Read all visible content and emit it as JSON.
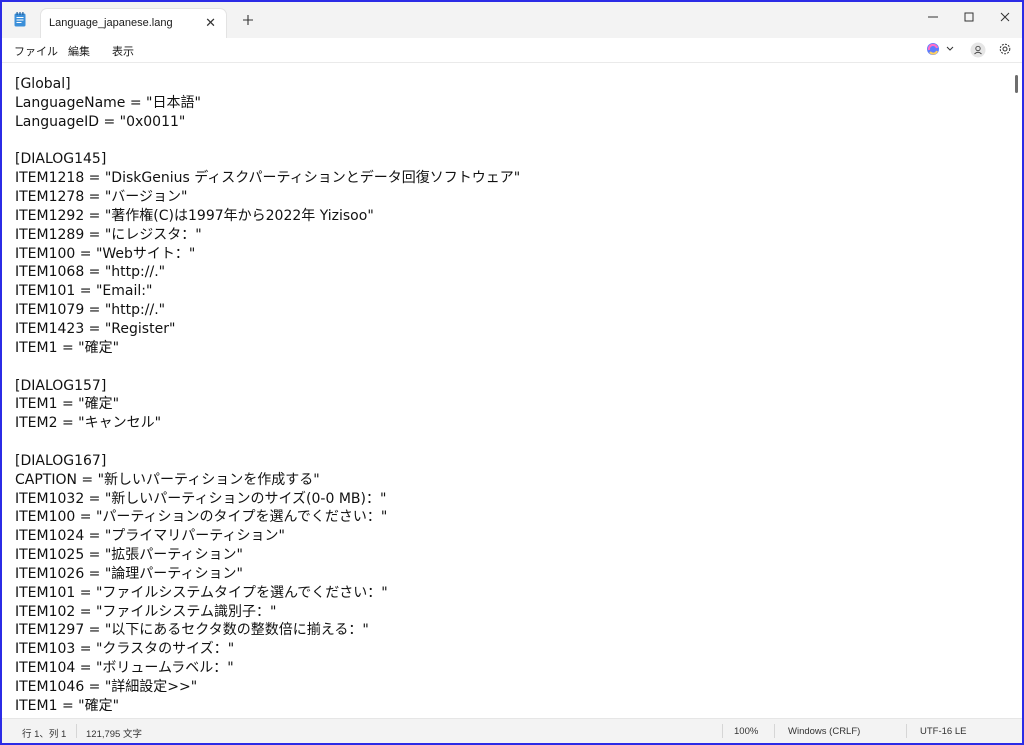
{
  "tab": {
    "title": "Language_japanese.lang"
  },
  "menu": {
    "file": "ファイル",
    "edit": "編集",
    "view": "表示"
  },
  "editor": {
    "lines": [
      "[Global]",
      "LanguageName = \"日本語\"",
      "LanguageID = \"0x0011\"",
      "",
      "[DIALOG145]",
      "ITEM1218 = \"DiskGenius ディスクパーティションとデータ回復ソフトウェア\"",
      "ITEM1278 = \"バージョン\"",
      "ITEM1292 = \"著作権(C)は1997年から2022年 Yizisoo\"",
      "ITEM1289 = \"にレジスタ：\"",
      "ITEM100 = \"Webサイト：\"",
      "ITEM1068 = \"http://.\"",
      "ITEM101 = \"Email:\"",
      "ITEM1079 = \"http://.\"",
      "ITEM1423 = \"Register\"",
      "ITEM1 = \"確定\"",
      "",
      "[DIALOG157]",
      "ITEM1 = \"確定\"",
      "ITEM2 = \"キャンセル\"",
      "",
      "[DIALOG167]",
      "CAPTION = \"新しいパーティションを作成する\"",
      "ITEM1032 = \"新しいパーティションのサイズ(0-0 MB)：\"",
      "ITEM100 = \"パーティションのタイプを選んでください：\"",
      "ITEM1024 = \"プライマリパーティション\"",
      "ITEM1025 = \"拡張パーティション\"",
      "ITEM1026 = \"論理パーティション\"",
      "ITEM101 = \"ファイルシステムタイプを選んでください：\"",
      "ITEM102 = \"ファイルシステム識別子：\"",
      "ITEM1297 = \"以下にあるセクタ数の整数倍に揃える：\"",
      "ITEM103 = \"クラスタのサイズ：\"",
      "ITEM104 = \"ボリュームラベル：\"",
      "ITEM1046 = \"詳細設定>>\"",
      "ITEM1 = \"確定\""
    ]
  },
  "status": {
    "position": "行 1、列 1",
    "char_count": "121,795 文字",
    "zoom": "100%",
    "line_ending": "Windows (CRLF)",
    "encoding": "UTF-16 LE"
  },
  "icons": {
    "app": "notepad-icon",
    "new_tab": "plus-icon",
    "copilot": "copilot-icon",
    "account": "account-icon",
    "settings": "gear-icon"
  }
}
